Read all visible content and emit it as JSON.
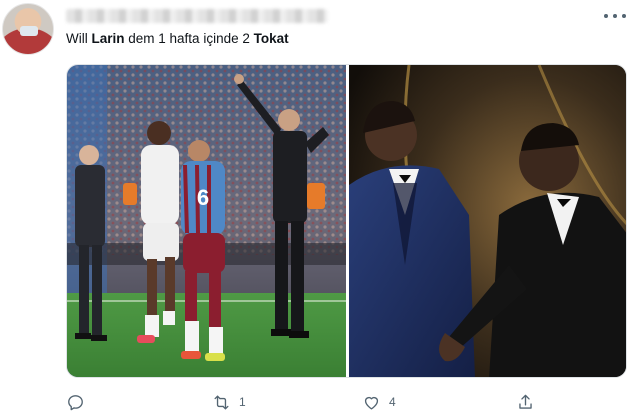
{
  "tweet": {
    "text_parts": [
      "Will ",
      "Larin",
      " dem 1 hafta içinde 2 ",
      "Tokat"
    ],
    "media": {
      "left_photo": {
        "player_number": "6"
      },
      "right_photo": {}
    },
    "actions": {
      "reply_icon": "reply-icon",
      "retweet_icon": "retweet-icon",
      "retweet_count": "1",
      "like_icon": "heart-icon",
      "like_count": "4",
      "share_icon": "share-icon"
    },
    "more_icon": "more-options-icon"
  },
  "colors": {
    "text": "#0f1419",
    "secondary": "#536471",
    "border": "#dfe3e6",
    "pitch_green": "#3f8a3a",
    "trabzon_claret": "#8b1e2f",
    "trabzon_blue": "#4f88c6"
  }
}
